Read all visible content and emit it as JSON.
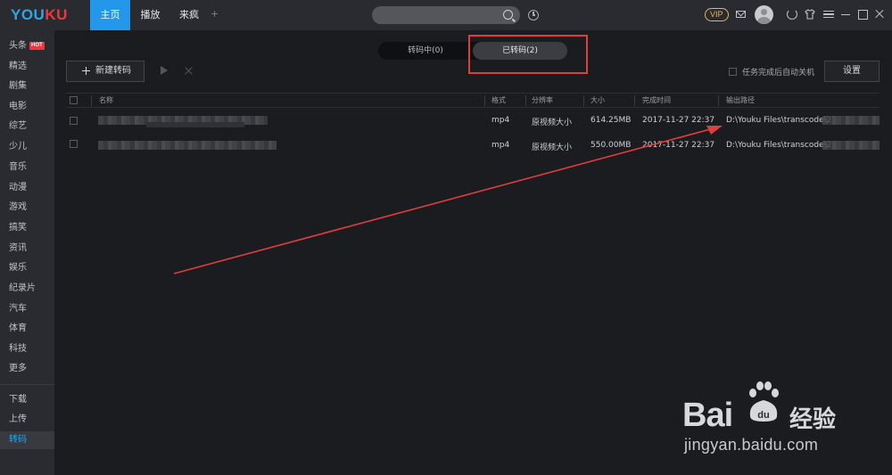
{
  "app": {
    "logo_part1": "YOU",
    "logo_part2": "KU",
    "brand_blue": "#2ba8e8",
    "brand_red": "#f0363b"
  },
  "nav": {
    "tabs": [
      {
        "label": "主页",
        "active": true
      },
      {
        "label": "播放",
        "active": false
      },
      {
        "label": "来疯",
        "active": false
      }
    ],
    "add_label": "+"
  },
  "titlebar": {
    "vip_label": "VIP"
  },
  "sidebar": {
    "items": [
      {
        "label": "头条",
        "badge": "HOT"
      },
      {
        "label": "精选"
      },
      {
        "label": "剧集"
      },
      {
        "label": "电影"
      },
      {
        "label": "综艺"
      },
      {
        "label": "少儿"
      },
      {
        "label": "音乐"
      },
      {
        "label": "动漫"
      },
      {
        "label": "游戏"
      },
      {
        "label": "搞笑"
      },
      {
        "label": "资讯"
      },
      {
        "label": "娱乐"
      },
      {
        "label": "纪录片"
      },
      {
        "label": "汽车"
      },
      {
        "label": "体育"
      },
      {
        "label": "科技"
      },
      {
        "label": "更多"
      }
    ],
    "bottom_items": [
      {
        "label": "下载"
      },
      {
        "label": "上传"
      },
      {
        "label": "转码",
        "active": true
      }
    ]
  },
  "segment": {
    "converting": "转码中(0)",
    "converted": "已转码(2)"
  },
  "toolbar": {
    "new_label": "新建转码",
    "auto_shutdown_label": "任务完成后自动关机",
    "settings_label": "设置"
  },
  "table": {
    "headers": {
      "name": "名称",
      "format": "格式",
      "resolution": "分辨率",
      "size": "大小",
      "time": "完成时间",
      "path": "输出路径"
    },
    "rows": [
      {
        "format": "mp4",
        "resolution": "原视频大小",
        "size": "614.25MB",
        "time": "2017-11-27 22:37",
        "path": "D:\\Youku Files\\transcode\\2"
      },
      {
        "format": "mp4",
        "resolution": "原视频大小",
        "size": "550.00MB",
        "time": "2017-11-27 22:37",
        "path": "D:\\Youku Files\\transcode\\2"
      }
    ]
  },
  "watermark": {
    "bai": "Bai",
    "du": "du",
    "jingyan": "经验",
    "url": "jingyan.baidu.com"
  },
  "annotation_color": "#e03e3e"
}
